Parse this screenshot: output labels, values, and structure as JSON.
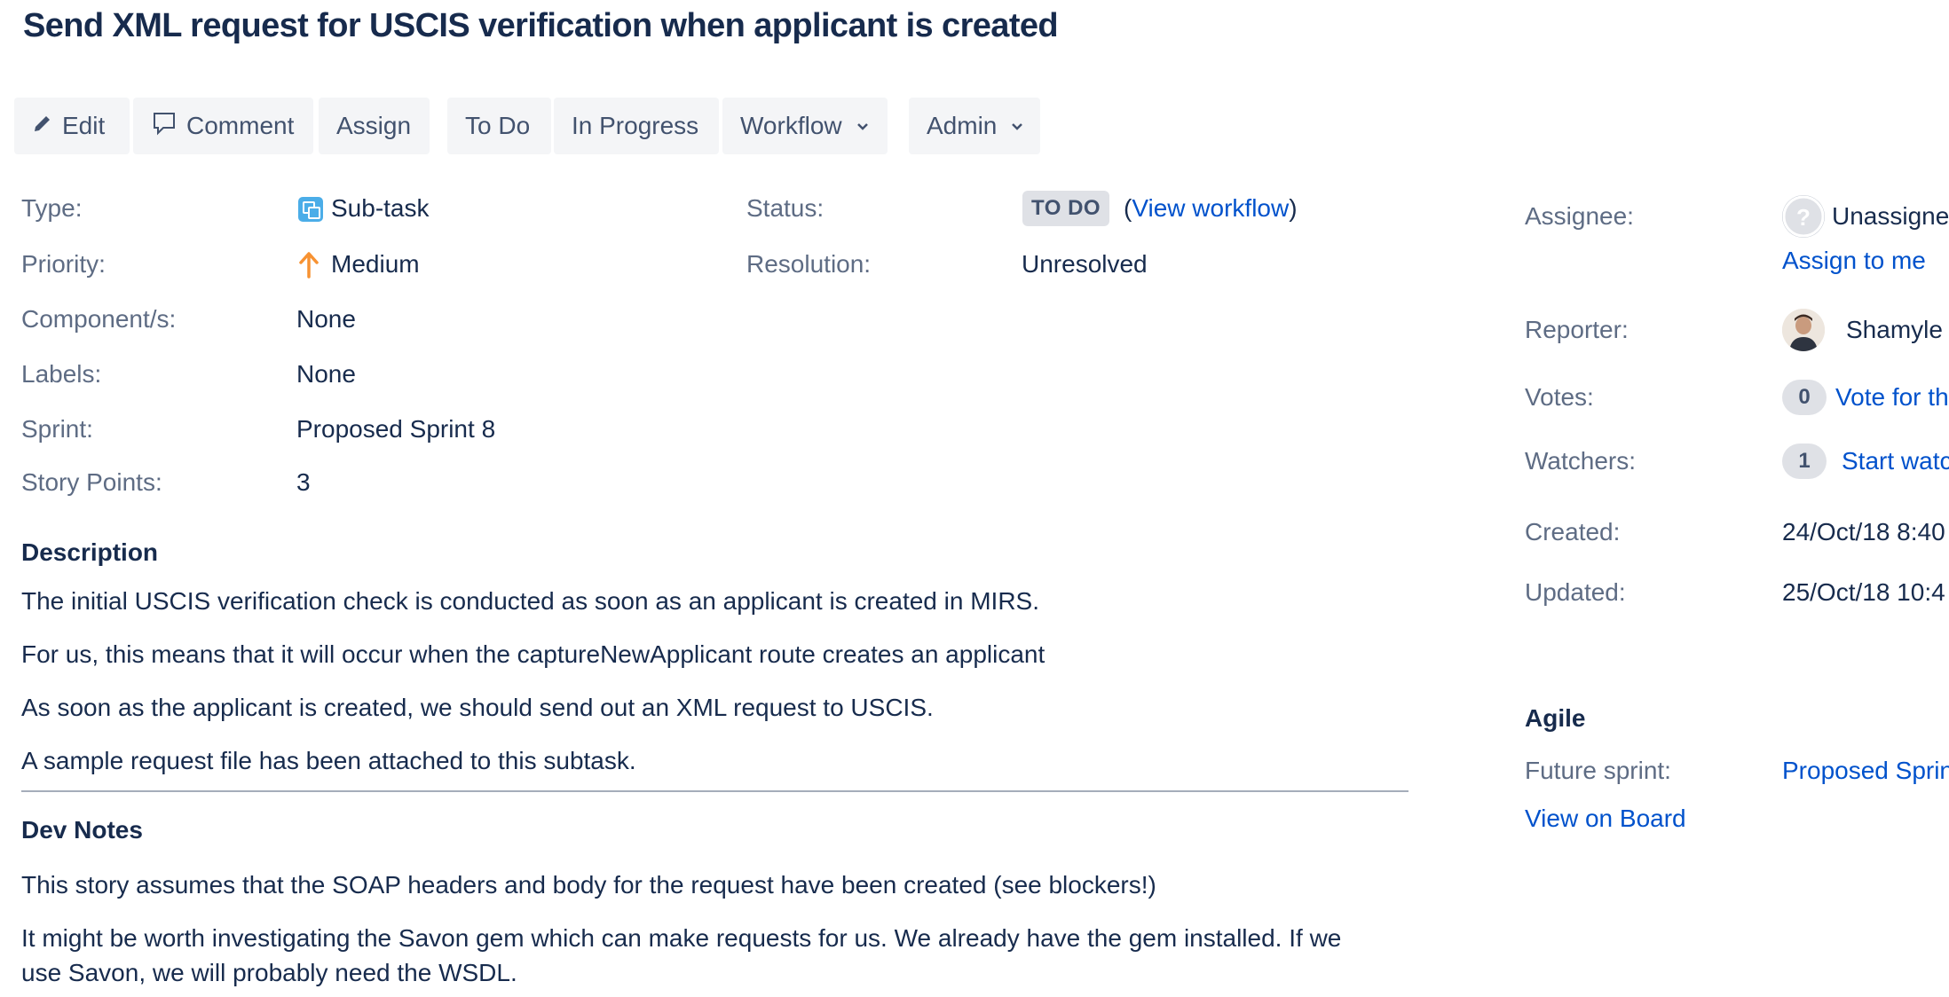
{
  "issue": {
    "title": "Send XML request for USCIS verification when applicant is created"
  },
  "toolbar": {
    "edit": "Edit",
    "comment": "Comment",
    "assign": "Assign",
    "todo": "To Do",
    "in_progress": "In Progress",
    "workflow": "Workflow",
    "admin": "Admin"
  },
  "details": {
    "type_label": "Type:",
    "type_value": "Sub-task",
    "priority_label": "Priority:",
    "priority_value": "Medium",
    "components_label": "Component/s:",
    "components_value": "None",
    "labels_label": "Labels:",
    "labels_value": "None",
    "sprint_label": "Sprint:",
    "sprint_value": "Proposed Sprint 8",
    "story_points_label": "Story Points:",
    "story_points_value": "3",
    "status_label": "Status:",
    "status_value": "TO DO",
    "view_workflow": "View workflow",
    "resolution_label": "Resolution:",
    "resolution_value": "Unresolved"
  },
  "description": {
    "heading": "Description",
    "paragraphs": [
      "The initial USCIS verification check is conducted as soon as an applicant is created in MIRS.",
      "For us, this means that it will occur when the captureNewApplicant route creates an applicant",
      "As soon as the applicant is created, we should send out an XML request to USCIS.",
      "A sample request file has been attached to this subtask."
    ]
  },
  "dev_notes": {
    "heading": "Dev Notes",
    "paragraphs": [
      "This story assumes that the SOAP headers and body for the request have been created (see blockers!)",
      "It might be worth investigating the Savon gem which can make requests for us. We already have the gem installed. If we",
      "use Savon, we will probably need the WSDL."
    ]
  },
  "people": {
    "assignee_label": "Assignee:",
    "assignee_value": "Unassigne",
    "assign_to_me": "Assign to me",
    "reporter_label": "Reporter:",
    "reporter_value": "Shamyle",
    "votes_label": "Votes:",
    "votes_count": "0",
    "vote_link": "Vote for th",
    "watchers_label": "Watchers:",
    "watchers_count": "1",
    "watch_link": "Start watc"
  },
  "dates": {
    "created_label": "Created:",
    "created_value": "24/Oct/18 8:40",
    "updated_label": "Updated:",
    "updated_value": "25/Oct/18 10:4"
  },
  "agile": {
    "heading": "Agile",
    "future_sprint_label": "Future sprint:",
    "future_sprint_value": "Proposed Sprin",
    "view_on_board": "View on Board"
  },
  "colors": {
    "link": "#0052CC",
    "text": "#172B4D",
    "label": "#5E6C84",
    "priority_medium": "#F79232",
    "subtask": "#4BADE8"
  }
}
